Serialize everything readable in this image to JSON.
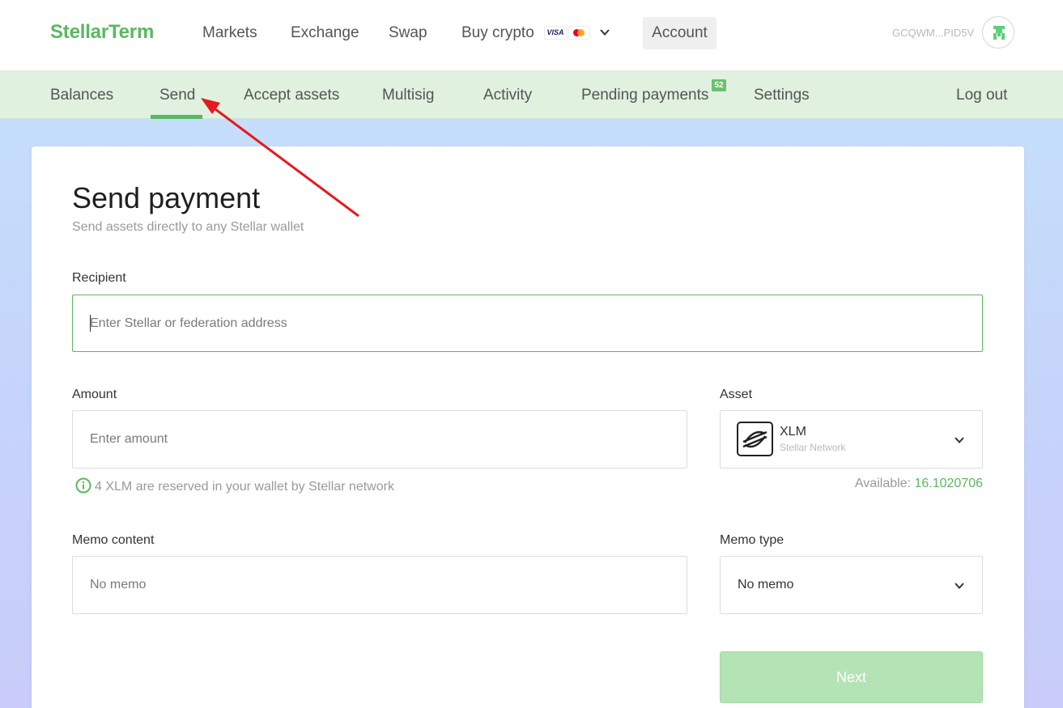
{
  "header": {
    "logo": "StellarTerm",
    "nav": [
      "Markets",
      "Exchange",
      "Swap",
      "Buy crypto"
    ],
    "card_icons": [
      "visa-icon",
      "mastercard-icon"
    ],
    "visa_text": "VISA",
    "account_label": "Account",
    "address": "GCQWM...PID5V"
  },
  "subnav": {
    "items": [
      "Balances",
      "Send",
      "Accept assets",
      "Multisig",
      "Activity",
      "Pending payments",
      "Settings",
      "Log out"
    ],
    "active": "Send",
    "pending_badge": "52"
  },
  "form": {
    "title": "Send payment",
    "subtitle": "Send assets directly to any Stellar wallet",
    "recipient_label": "Recipient",
    "recipient_placeholder": "Enter Stellar or federation address",
    "amount_label": "Amount",
    "amount_placeholder": "Enter amount",
    "reserve_hint": "4 XLM are reserved in your wallet by Stellar network",
    "asset_label": "Asset",
    "asset_code": "XLM",
    "asset_network": "Stellar Network",
    "available_label": "Available:",
    "available_amount": "16.1020706",
    "memo_content_label": "Memo content",
    "memo_content_placeholder": "No memo",
    "memo_type_label": "Memo type",
    "memo_type_value": "No memo",
    "next_label": "Next"
  },
  "colors": {
    "brand_green": "#5ab85f",
    "subnav_bg": "#e0f1e0",
    "next_disabled": "#b4e3b6",
    "annotation_red": "#e8191c"
  }
}
